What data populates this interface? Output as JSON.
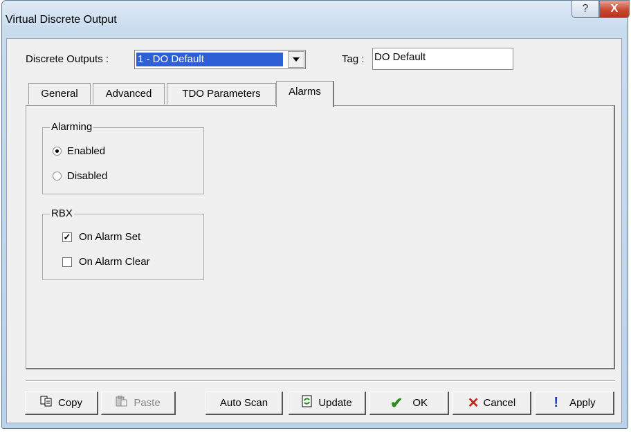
{
  "window": {
    "title": "Virtual Discrete Output",
    "help_label": "?",
    "close_label": "X"
  },
  "header": {
    "discrete_outputs_label": "Discrete Outputs :",
    "discrete_outputs_value": "1 - DO Default",
    "tag_label": "Tag :",
    "tag_value": "DO Default"
  },
  "tabs": [
    {
      "label": "General"
    },
    {
      "label": "Advanced"
    },
    {
      "label": "TDO Parameters"
    },
    {
      "label": "Alarms",
      "active": true
    }
  ],
  "alarming": {
    "label": "Alarming",
    "options": [
      {
        "label": "Enabled",
        "selected": true
      },
      {
        "label": "Disabled",
        "selected": false
      }
    ]
  },
  "rbx": {
    "label": "RBX",
    "options": [
      {
        "label": "On Alarm Set",
        "checked": true
      },
      {
        "label": "On Alarm Clear",
        "checked": false
      }
    ]
  },
  "buttons": {
    "copy": "Copy",
    "paste": "Paste",
    "auto_scan": "Auto Scan",
    "update": "Update",
    "ok": "OK",
    "cancel": "Cancel",
    "apply": "Apply"
  },
  "colors": {
    "selection": "#2f5fd7",
    "ok_check": "#2c8a1e",
    "cancel_x": "#c0241a",
    "apply_mark": "#1c3fc0"
  },
  "icons": [
    "copy-icon",
    "paste-icon",
    "update-icon",
    "ok-check-icon",
    "cancel-x-icon",
    "apply-exclamation-icon",
    "dropdown-arrow-icon",
    "help-icon",
    "close-icon"
  ]
}
